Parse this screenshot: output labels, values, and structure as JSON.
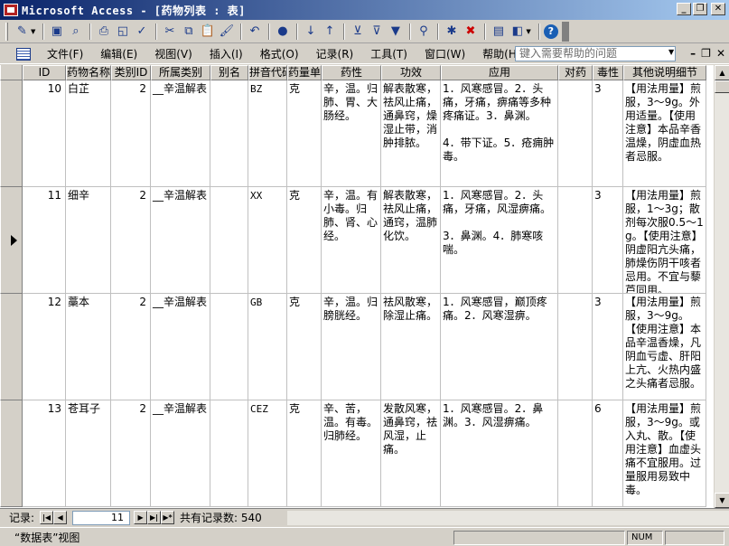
{
  "window": {
    "title": "Microsoft Access - [药物列表 : 表]"
  },
  "toolbar": {
    "icons": [
      "design-view-icon",
      "save-icon",
      "file-search-icon",
      "print-icon",
      "print-preview-icon",
      "spelling-icon",
      "cut-icon",
      "copy-icon",
      "paste-icon",
      "format-painter-icon",
      "undo-icon",
      "insert-hyperlink-icon",
      "sort-ascending-icon",
      "sort-descending-icon",
      "filter-by-selection-icon",
      "filter-by-form-icon",
      "apply-filter-icon",
      "find-icon",
      "new-record-icon",
      "delete-record-icon",
      "database-window-icon",
      "new-object-icon",
      "help-icon"
    ]
  },
  "menu": {
    "items": [
      "文件(F)",
      "编辑(E)",
      "视图(V)",
      "插入(I)",
      "格式(O)",
      "记录(R)",
      "工具(T)",
      "窗口(W)",
      "帮助(H)"
    ],
    "help_placeholder": "键入需要帮助的问题"
  },
  "table": {
    "columns": [
      "ID",
      "药物名称",
      "类别ID",
      "所属类别",
      "别名",
      "拼音代码",
      "药量单位",
      "药性",
      "功效",
      "应用",
      "对药",
      "毒性",
      "其他说明细节"
    ],
    "rows": [
      {
        "id": "10",
        "name": "白芷",
        "category_id": "2",
        "category": "__辛温解表",
        "alias": "",
        "pinyin": "BZ",
        "unit": "克",
        "nature": "辛，温。归肺、胃、大肠经。",
        "effect": "解表散寒，祛风止痛，通鼻窍，燥湿止带，消肿排脓。",
        "usage": "1．风寒感冒。2．头痛，牙痛，痹痛等多种疼痛证。3．鼻渊。\n\n4．带下证。5．疮痈肿毒。",
        "pair": "",
        "toxicity": "3",
        "notes": "【用法用量】煎服，3～9g。外用适量。【使用注意】本品辛香温燥，阴虚血热者忌服。"
      },
      {
        "id": "11",
        "name": "细辛",
        "category_id": "2",
        "category": "__辛温解表",
        "alias": "",
        "pinyin": "XX",
        "unit": "克",
        "nature": "辛，温。有小毒。归肺、肾、心经。",
        "effect": "解表散寒，祛风止痛，通窍，温肺化饮。",
        "usage": "1．风寒感冒。2．头痛，牙痛，风湿痹痛。\n\n3．鼻渊。4．肺寒咳喘。",
        "pair": "",
        "toxicity": "3",
        "notes": "【用法用量】煎服，1～3g；散剂每次服0.5～1g。【使用注意】阴虚阳亢头痛，肺燥伤阴干咳者忌用。不宜与藜芦同用。"
      },
      {
        "id": "12",
        "name": "藁本",
        "category_id": "2",
        "category": "__辛温解表",
        "alias": "",
        "pinyin": "GB",
        "unit": "克",
        "nature": "辛，温。归膀胱经。",
        "effect": "祛风散寒，除湿止痛。",
        "usage": "1．风寒感冒，巅顶疼痛。2．风寒湿痹。",
        "pair": "",
        "toxicity": "3",
        "notes": "【用法用量】煎服，3～9g。【使用注意】本品辛温香燥，凡阴血亏虚、肝阳上亢、火热内盛之头痛者忌服。"
      },
      {
        "id": "13",
        "name": "苍耳子",
        "category_id": "2",
        "category": "__辛温解表",
        "alias": "",
        "pinyin": "CEZ",
        "unit": "克",
        "nature": "辛、苦，温。有毒。归肺经。",
        "effect": "发散风寒，通鼻窍，祛风湿，止痛。",
        "usage": "1．风寒感冒。2．鼻渊。3．风湿痹痛。",
        "pair": "",
        "toxicity": "6",
        "notes": "【用法用量】煎服，3～9g。或入丸、散。【使用注意】血虚头痛不宜服用。过量服用易致中毒。"
      }
    ]
  },
  "navigation": {
    "label": "记录:",
    "current_record": "11",
    "total_text": "共有记录数: 540"
  },
  "status": {
    "view_text": "“数据表”视图",
    "num_lock": "NUM"
  }
}
